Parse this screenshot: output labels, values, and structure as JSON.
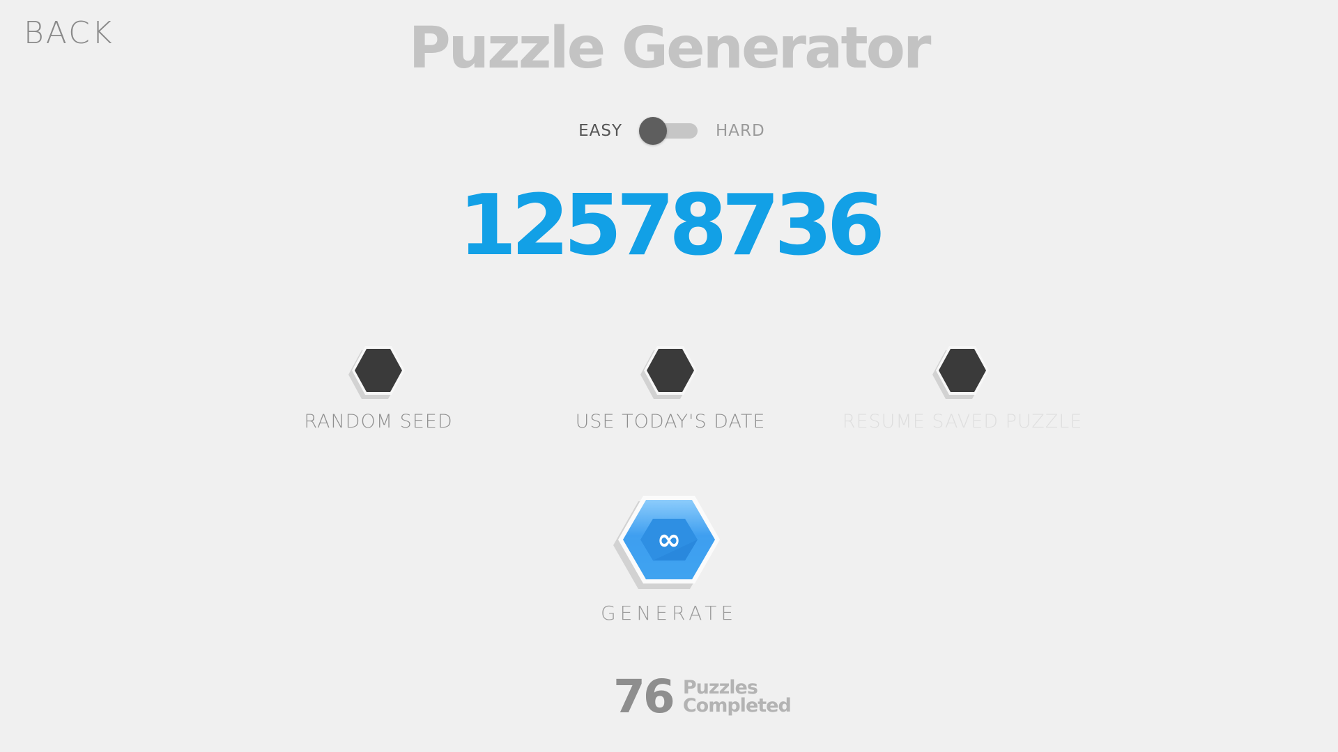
{
  "header": {
    "back_label": "BACK",
    "title": "Puzzle Generator"
  },
  "difficulty": {
    "easy_label": "EASY",
    "hard_label": "HARD",
    "selected": "EASY"
  },
  "seed": {
    "value": "12578736"
  },
  "options": {
    "random_seed_label": "RANDOM SEED",
    "use_todays_date_label": "USE TODAY'S DATE",
    "resume_saved_puzzle_label": "RESUME SAVED PUZZLE",
    "resume_enabled": false
  },
  "generate": {
    "icon_symbol": "∞",
    "label": "GENERATE"
  },
  "stats": {
    "count": "76",
    "caption_line1": "Puzzles",
    "caption_line2": "Completed"
  },
  "colors": {
    "background": "#f0f0f0",
    "accent_blue": "#12a0e6",
    "hex_dark": "#3a3a3a",
    "title_gray": "#c3c3c3"
  }
}
